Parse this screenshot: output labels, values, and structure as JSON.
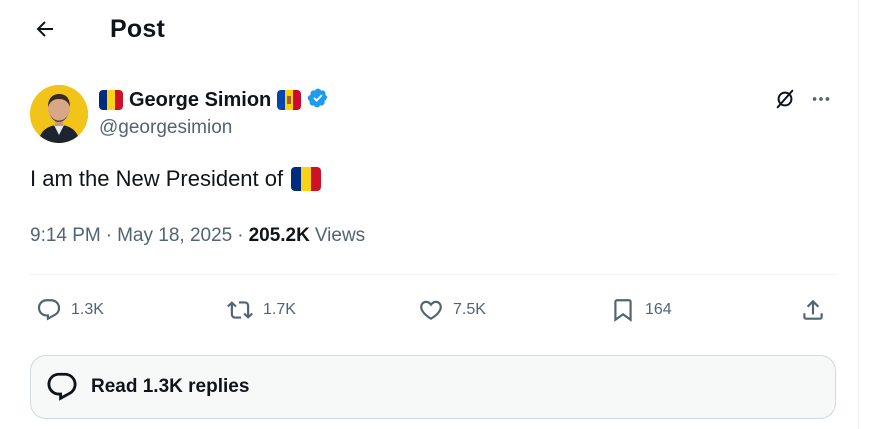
{
  "header": {
    "title": "Post",
    "back_icon": "arrow-left-icon"
  },
  "author": {
    "display_name": "George Simion",
    "handle": "@georgesimion",
    "verified": true,
    "name_flags": [
      "romania-flag",
      "moldova-flag"
    ],
    "avatar_icon": "avatar"
  },
  "tweet": {
    "text": "I am the New President of",
    "trailing_emoji": "romania-flag"
  },
  "meta": {
    "time": "9:14 PM",
    "sep1": "·",
    "date": "May 18, 2025",
    "sep2": "·",
    "views_count": "205.2K",
    "views_label": "Views"
  },
  "actions": {
    "replies": "1.3K",
    "reposts": "1.7K",
    "likes": "7.5K",
    "bookmarks": "164"
  },
  "read_replies": {
    "label": "Read 1.3K replies"
  },
  "colors": {
    "text": "#0f1419",
    "secondary": "#536471",
    "verified": "#1d9bf0",
    "border": "#cfd9de"
  }
}
